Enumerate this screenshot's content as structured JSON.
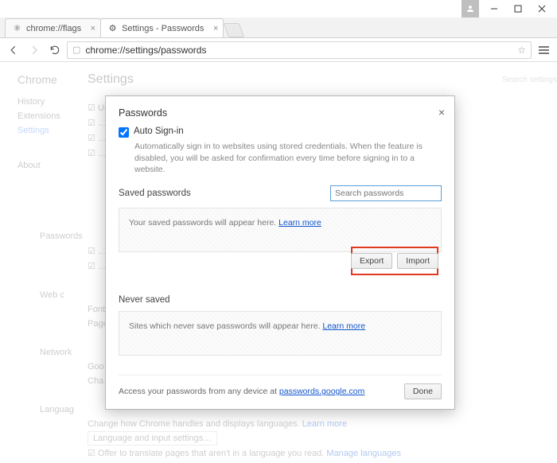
{
  "window": {
    "url": "chrome://settings/passwords"
  },
  "tabs": [
    {
      "title": "chrome://flags"
    },
    {
      "title": "Settings - Passwords"
    }
  ],
  "bg": {
    "brand": "Chrome",
    "pageTitle": "Settings",
    "sidebar": [
      "History",
      "Extensions",
      "Settings",
      "About"
    ],
    "line1": "Use a web service to help resolve navigation errors",
    "sections": [
      "Passwords",
      "Web c",
      "Network",
      "Languag"
    ],
    "langLine": "Change how Chrome handles and displays languages.",
    "langBtn": "Language and input settings…",
    "transLine": "Offer to translate pages that aren't in a language you read.",
    "learn": "Learn more",
    "manage": "Manage languages",
    "searchPlaceholder": "Search settings"
  },
  "dialog": {
    "title": "Passwords",
    "autoSigninLabel": "Auto Sign-in",
    "autoSigninDesc": "Automatically sign in to websites using stored credentials. When the feature is disabled, you will be asked for confirmation every time before signing in to a website.",
    "savedHeader": "Saved passwords",
    "searchPlaceholder": "Search passwords",
    "savedEmpty": "Your saved passwords will appear here.",
    "learnMore": "Learn more",
    "exportBtn": "Export",
    "importBtn": "Import",
    "neverHeader": "Never saved",
    "neverEmpty": "Sites which never save passwords will appear here.",
    "footerText": "Access your passwords from any device at ",
    "footerLink": "passwords.google.com",
    "doneBtn": "Done"
  }
}
